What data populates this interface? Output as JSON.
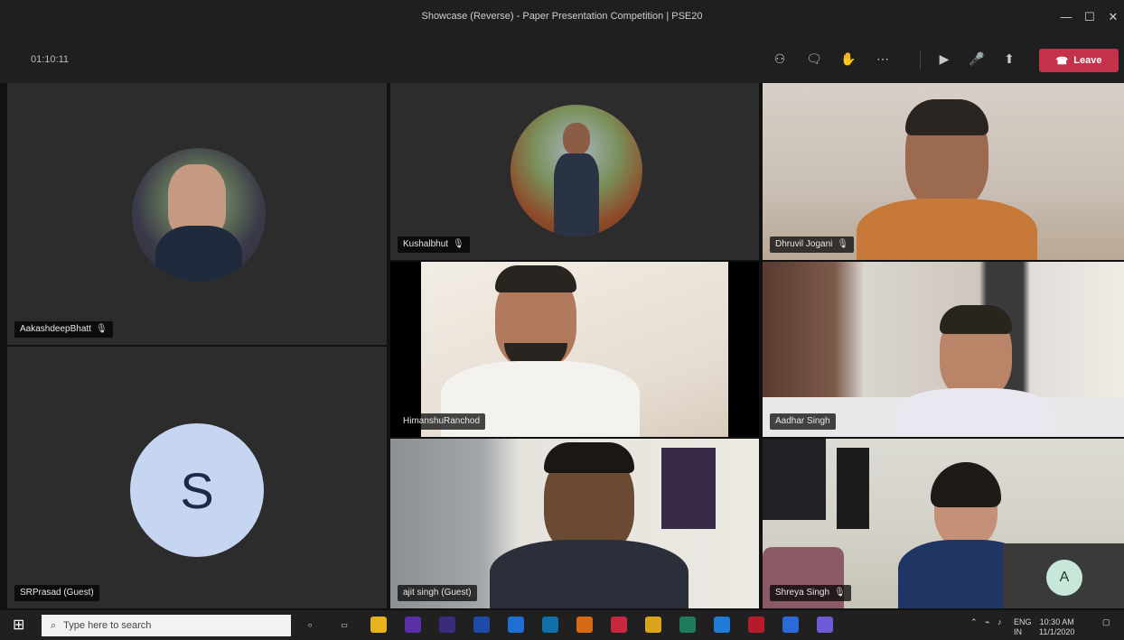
{
  "window": {
    "title": "Showcase (Reverse) - Paper Presentation Competition | PSE20"
  },
  "meeting": {
    "timer": "01:10:11",
    "leave_label": "Leave"
  },
  "participants": {
    "p1": {
      "name": "AakashdeepBhatt"
    },
    "p2": {
      "name": "Kushalbhut"
    },
    "p3": {
      "name": "Dhruvil Jogani"
    },
    "p4": {
      "name": "HimanshuRanchod"
    },
    "p5": {
      "name": "Aadhar Singh"
    },
    "p6": {
      "name": "SRPrasad (Guest)",
      "initial": "S"
    },
    "p7": {
      "name": "ajit singh (Guest)"
    },
    "p8": {
      "name": "Shreya Singh"
    },
    "self": {
      "initial": "A"
    }
  },
  "taskbar": {
    "search_placeholder": "Type here to search",
    "tray_lang": "ENG",
    "tray_region": "IN",
    "clock_time": "10:30 AM",
    "clock_date": "11/1/2020"
  }
}
